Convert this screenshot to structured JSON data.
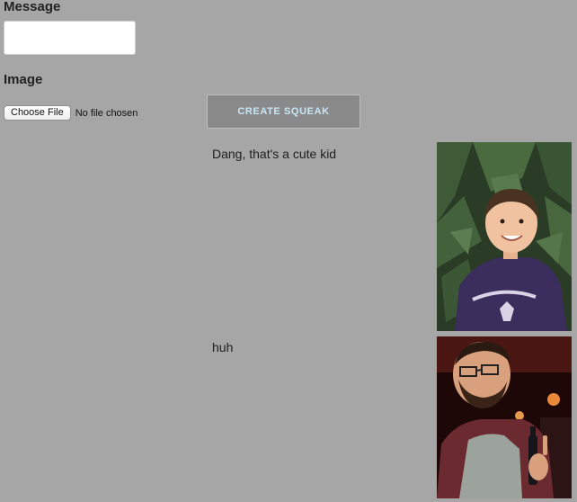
{
  "form": {
    "message_label": "Message",
    "message_value": "",
    "image_label": "Image",
    "file_button_label": "Choose File",
    "file_status": "No file chosen",
    "submit_label": "CREATE SQUEAK"
  },
  "squeaks": [
    {
      "text": "Dang, that's a cute kid",
      "image_alt": "smiling boy in purple t-shirt in front of evergreen tree"
    },
    {
      "text": "huh",
      "image_alt": "man with glasses holding a bottle, pointing upward"
    }
  ],
  "colors": {
    "page_background": "#a6a6a6",
    "button_background": "#8a8a8a",
    "button_text": "#c8e6f5"
  }
}
